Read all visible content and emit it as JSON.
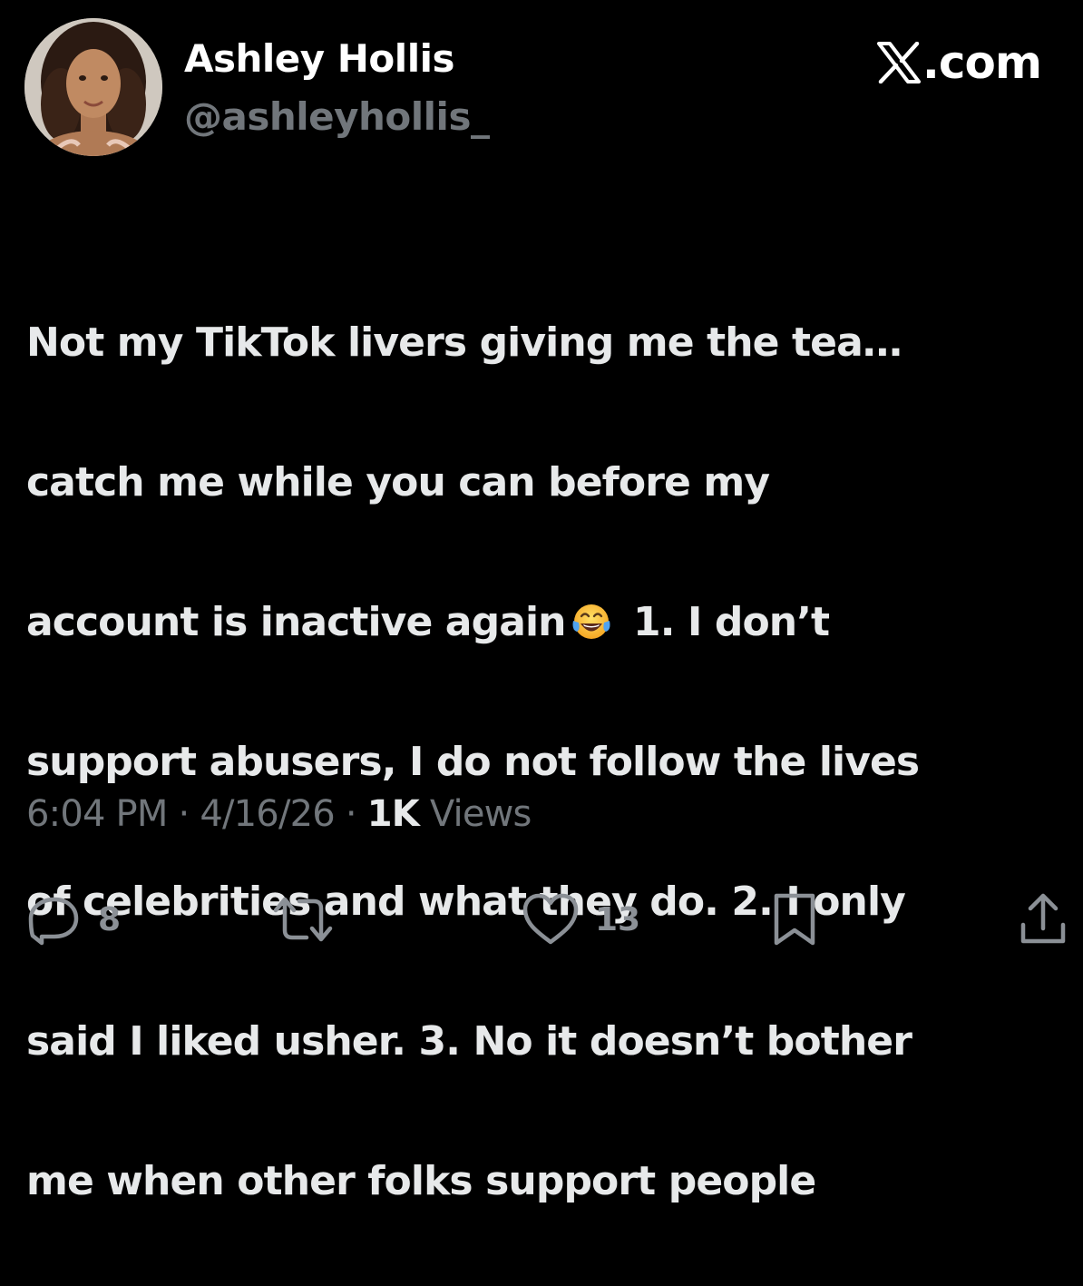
{
  "author": {
    "name": "Ashley Hollis",
    "handle": "@ashleyhollis_"
  },
  "source": {
    "label": ".com",
    "icon": "x-logo-icon"
  },
  "tweet": {
    "lines": [
      "Not my TikTok livers giving me the tea…",
      "catch me while you can before my",
      "account is inactive again",
      " 1. I don’t",
      "support abusers, I do not follow the lives",
      "of celebrities and what they do. 2. I only",
      "said I liked usher. 3. No it doesn’t bother",
      "me when other folks support people"
    ],
    "emoji": "face-with-tears-of-joy-icon"
  },
  "meta": {
    "time": "6:04 PM",
    "separator": " · ",
    "date": "4/16/26",
    "views_count": "1K",
    "views_label": " Views"
  },
  "actions": {
    "reply_count": "8",
    "like_count": "13",
    "icons": [
      "reply-icon",
      "retweet-icon",
      "like-icon",
      "bookmark-icon",
      "share-icon"
    ]
  },
  "colors": {
    "background": "#000000",
    "text_primary": "#e7e9ea",
    "text_secondary": "#71767b"
  }
}
